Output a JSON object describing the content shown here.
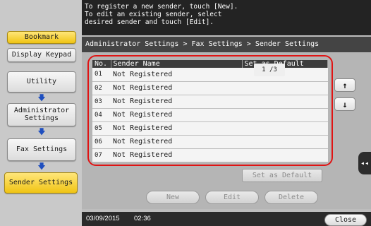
{
  "nav": {
    "bookmark": "Bookmark",
    "display_keypad": "Display Keypad",
    "utility": "Utility",
    "administrator_settings": "Administrator Settings",
    "fax_settings": "Fax Settings",
    "sender_settings": "Sender Settings",
    "arrow_icon": "arrow-down-icon",
    "arrow_glyph": "🡇"
  },
  "instruction": {
    "text": "To register a new sender, touch [New].\nTo edit an existing sender, select\ndesired sender and touch [Edit]."
  },
  "breadcrumb": "Administrator Settings > Fax Settings > Sender Settings",
  "table": {
    "headers": {
      "no": "No.",
      "name": "Sender Name",
      "default": "Set as Default"
    },
    "rows": [
      {
        "no": "01",
        "name": "Not Registered",
        "default": ""
      },
      {
        "no": "02",
        "name": "Not Registered",
        "default": ""
      },
      {
        "no": "03",
        "name": "Not Registered",
        "default": ""
      },
      {
        "no": "04",
        "name": "Not Registered",
        "default": ""
      },
      {
        "no": "05",
        "name": "Not Registered",
        "default": ""
      },
      {
        "no": "06",
        "name": "Not Registered",
        "default": ""
      },
      {
        "no": "07",
        "name": "Not Registered",
        "default": ""
      }
    ]
  },
  "paging": {
    "indicator": "1 /3",
    "up_glyph": "↑",
    "down_glyph": "↓"
  },
  "actions": {
    "set_as_default": "Set as Default",
    "new": "New",
    "edit": "Edit",
    "delete": "Delete"
  },
  "side_tab": {
    "glyph": "◂◂"
  },
  "footer": {
    "date": "03/09/2015",
    "time": "02:36",
    "close": "Close"
  },
  "colors": {
    "highlight_frame": "#e01414",
    "selected_nav": "#f0c414"
  }
}
